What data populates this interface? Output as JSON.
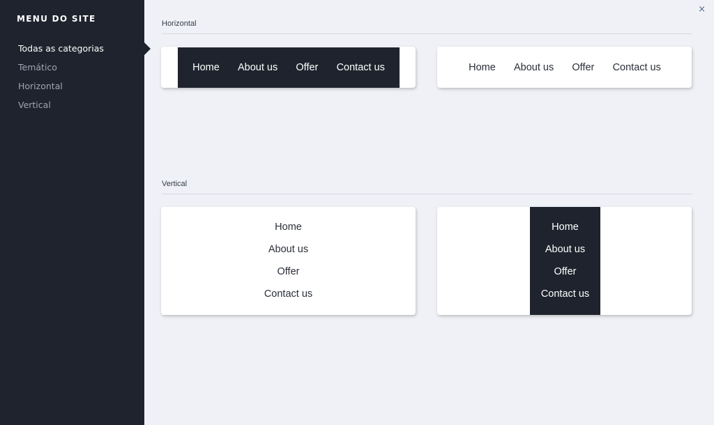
{
  "sidebar": {
    "title": "MENU DO SITE",
    "items": [
      {
        "label": "Todas as categorias"
      },
      {
        "label": "Temático"
      },
      {
        "label": "Horizontal"
      },
      {
        "label": "Vertical"
      }
    ]
  },
  "close_label": "×",
  "sections": {
    "horizontal": {
      "label": "Horizontal",
      "cards": [
        {
          "style": "dark",
          "items": [
            "Home",
            "About us",
            "Offer",
            "Contact us"
          ]
        },
        {
          "style": "light",
          "items": [
            "Home",
            "About us",
            "Offer",
            "Contact us"
          ]
        }
      ]
    },
    "vertical": {
      "label": "Vertical",
      "cards": [
        {
          "style": "light",
          "items": [
            "Home",
            "About us",
            "Offer",
            "Contact us"
          ]
        },
        {
          "style": "dark",
          "items": [
            "Home",
            "About us",
            "Offer",
            "Contact us"
          ]
        }
      ]
    }
  },
  "colors": {
    "sidebar_bg": "#1e232d",
    "page_bg": "#eff1f6",
    "dark_menu_bg": "#1e232d",
    "sidebar_text_active": "#ffffff",
    "sidebar_text": "#9ea6b4"
  }
}
